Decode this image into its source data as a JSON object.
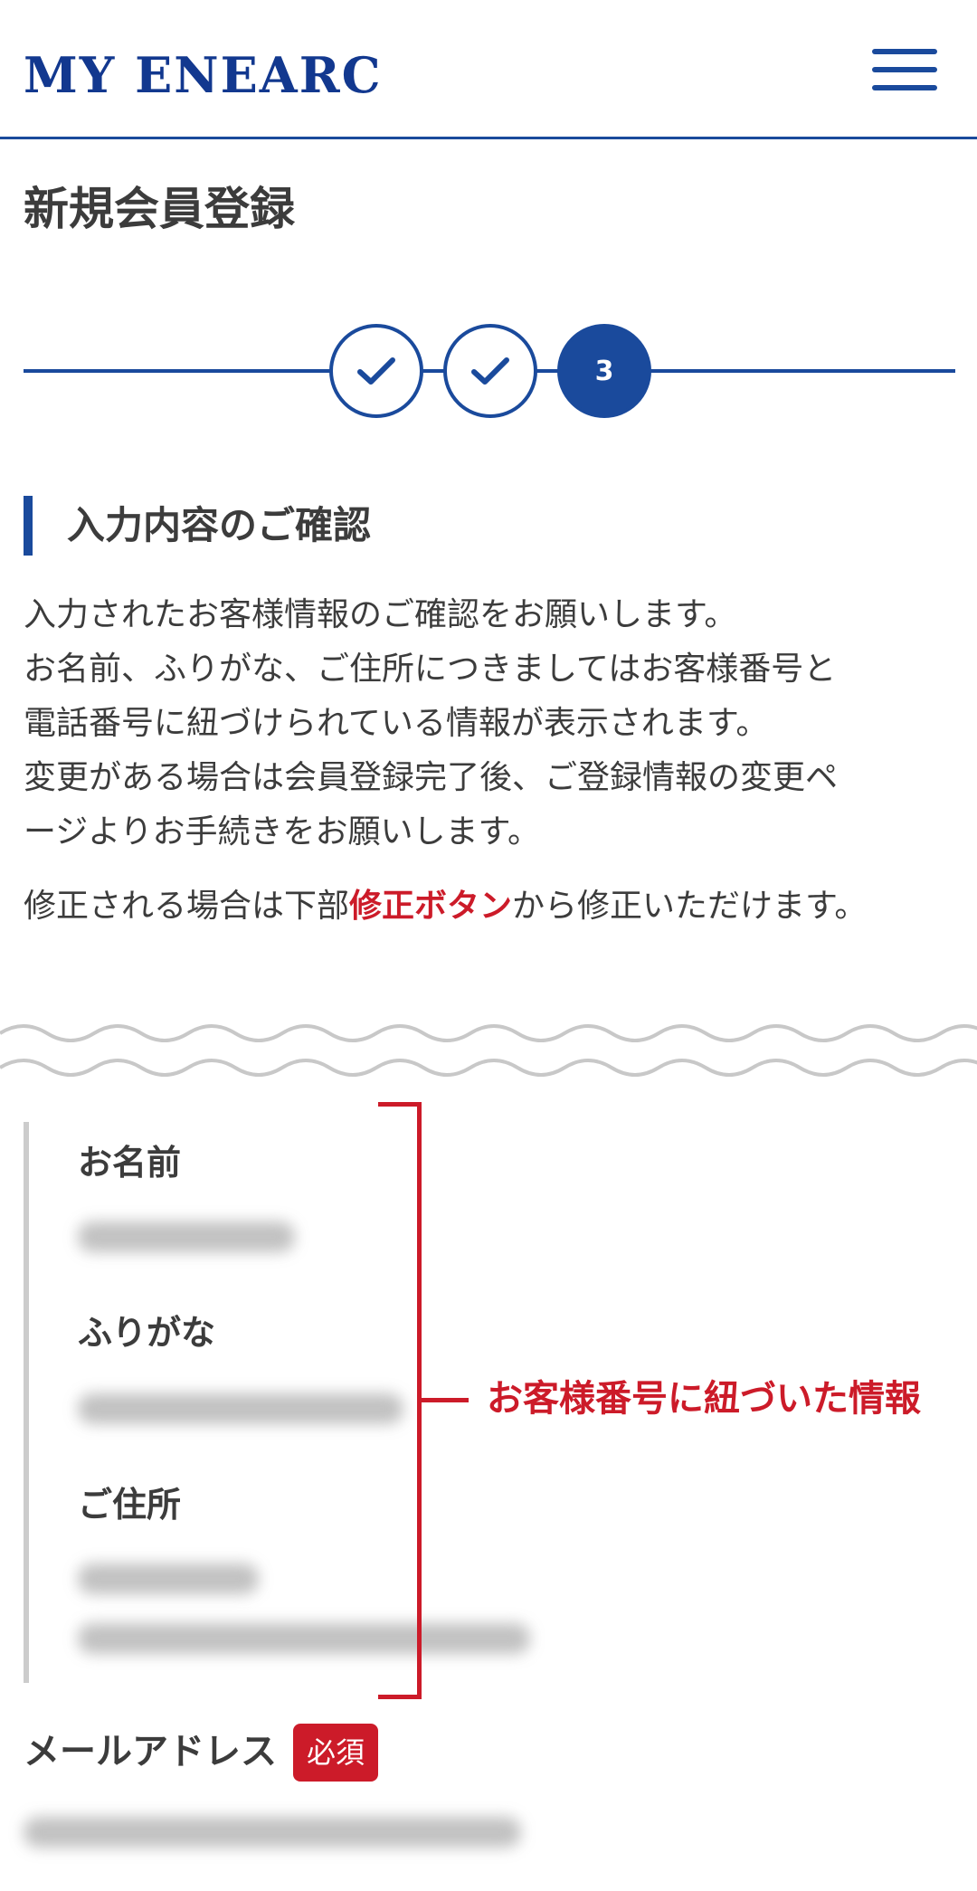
{
  "header": {
    "logo": "MY ENEARC",
    "menu_icon": "hamburger-menu-icon"
  },
  "page_title": "新規会員登録",
  "stepper": {
    "steps": [
      {
        "state": "done",
        "icon": "check-icon"
      },
      {
        "state": "done",
        "icon": "check-icon"
      },
      {
        "state": "current",
        "label": "3"
      }
    ]
  },
  "section_heading": "入力内容のご確認",
  "description_lines": [
    "入力されたお客様情報のご確認をお願いします。",
    "お名前、ふりがな、ご住所につきましてはお客様番号と",
    "電話番号に紐づけられている情報が表示されます。",
    "変更がある場合は会員登録完了後、ご登録情報の変更ペ",
    "ージよりお手続きをお願いします。"
  ],
  "note": {
    "before": "修正される場合は下部",
    "highlight": "修正ボタン",
    "after": "から修正いただけます。"
  },
  "info": {
    "name_label": "お名前",
    "furigana_label": "ふりがな",
    "address_label": "ご住所"
  },
  "annotation": "お客様番号に紐づいた情報",
  "email": {
    "label": "メールアドレス",
    "required_badge": "必須"
  },
  "colors": {
    "brand": "#1a4a9c",
    "accent_red": "#cc1b29",
    "text": "#3c3c3c",
    "divider": "#cccccc"
  }
}
